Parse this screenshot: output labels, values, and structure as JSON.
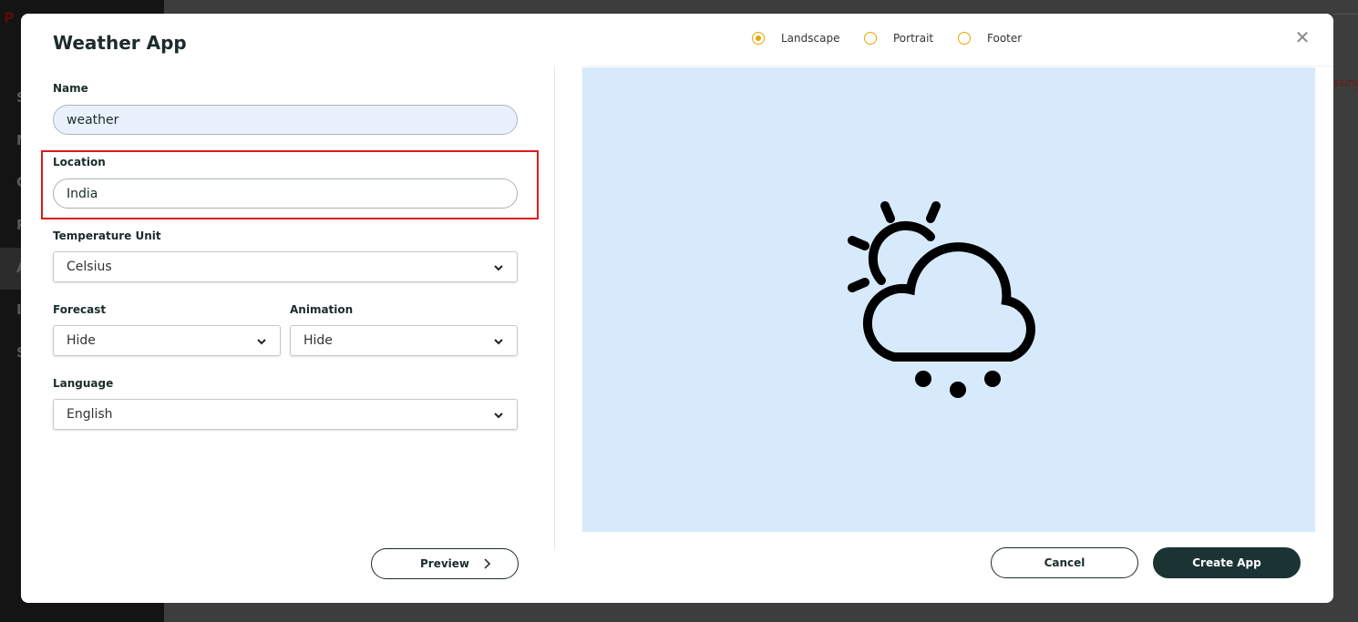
{
  "modal": {
    "title": "Weather App",
    "orientation_options": [
      {
        "label": "Landscape",
        "checked": true
      },
      {
        "label": "Portrait",
        "checked": false
      },
      {
        "label": "Footer",
        "checked": false
      }
    ]
  },
  "form": {
    "name": {
      "label": "Name",
      "value": "weather"
    },
    "location": {
      "label": "Location",
      "value": "India"
    },
    "temperature_unit": {
      "label": "Temperature Unit",
      "value": "Celsius"
    },
    "forecast": {
      "label": "Forecast",
      "value": "Hide"
    },
    "animation": {
      "label": "Animation",
      "value": "Hide"
    },
    "language": {
      "label": "Language",
      "value": "English"
    }
  },
  "buttons": {
    "preview": "Preview",
    "cancel": "Cancel",
    "create": "Create App"
  },
  "preview": {
    "icon": "partly-cloudy-hail-icon",
    "background_color": "#d6eafc"
  },
  "colors": {
    "accent": "#e8a400",
    "primary_dark": "#1c3333",
    "highlight": "#e01818"
  }
}
